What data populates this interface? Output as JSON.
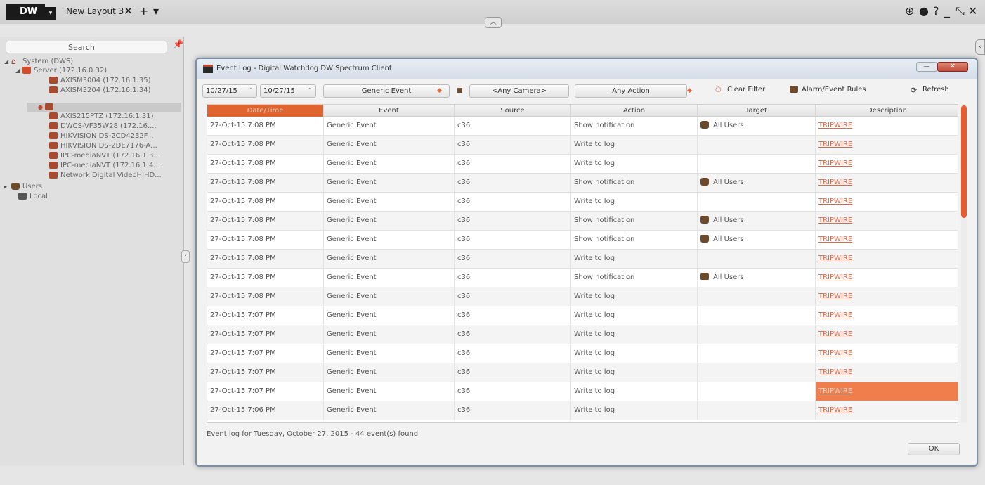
{
  "topbar": {
    "logo": "DW",
    "layout_tab": "New Layout 3",
    "tab_close": "✕",
    "tab_add": "+",
    "tab_menu": "▾",
    "right_icons": [
      "⊕",
      "●",
      "?",
      "_",
      "⤡",
      "✕"
    ]
  },
  "sidebar": {
    "search_placeholder": "Search",
    "tree": [
      {
        "label": "System (DWS)",
        "type": "home"
      },
      {
        "label": "Server (172.16.0.32)",
        "type": "server"
      },
      {
        "label": "AXISM3004 (172.16.1.35)",
        "type": "camera"
      },
      {
        "label": "AXISM3204 (172.16.1.34)",
        "type": "camera"
      },
      {
        "label": "",
        "type": "camera"
      },
      {
        "label": "AXIS215PTZ (172.16.1.31)",
        "type": "camera"
      },
      {
        "label": "DWCS-VF35W28 (172.16....",
        "type": "camera"
      },
      {
        "label": "HIKVISION DS-2CD4232F...",
        "type": "camera"
      },
      {
        "label": "HIKVISION DS-2DE7176-A...",
        "type": "camera"
      },
      {
        "label": "IPC-mediaNVT (172.16.1.3...",
        "type": "camera"
      },
      {
        "label": "IPC-mediaNVT (172.16.1.4...",
        "type": "camera"
      },
      {
        "label": "Network Digital VideoHIHD...",
        "type": "camera"
      },
      {
        "label": "Users",
        "type": "users"
      },
      {
        "label": "Local",
        "type": "local"
      }
    ]
  },
  "dialog": {
    "title": "Event Log - Digital Watchdog DW Spectrum Client",
    "minimize": "—",
    "close": "✕",
    "filters": {
      "date_from": "10/27/15",
      "date_to": "10/27/15",
      "event_type": "Generic Event",
      "camera": "<Any Camera>",
      "action": "Any Action",
      "clear_filter": "Clear Filter",
      "alarm_rules": "Alarm/Event Rules",
      "refresh": "Refresh"
    },
    "columns": [
      "Date/Time",
      "Event",
      "Source",
      "Action",
      "Target",
      "Description"
    ],
    "rows": [
      {
        "date": "27-Oct-15 7:08 PM",
        "event": "Generic Event",
        "source": "c36",
        "action": "Show notification",
        "target": "All Users",
        "desc": "TRIPWIRE"
      },
      {
        "date": "27-Oct-15 7:08 PM",
        "event": "Generic Event",
        "source": "c36",
        "action": "Write to log",
        "target": "",
        "desc": "TRIPWIRE"
      },
      {
        "date": "27-Oct-15 7:08 PM",
        "event": "Generic Event",
        "source": "c36",
        "action": "Write to log",
        "target": "",
        "desc": "TRIPWIRE"
      },
      {
        "date": "27-Oct-15 7:08 PM",
        "event": "Generic Event",
        "source": "c36",
        "action": "Show notification",
        "target": "All Users",
        "desc": "TRIPWIRE"
      },
      {
        "date": "27-Oct-15 7:08 PM",
        "event": "Generic Event",
        "source": "c36",
        "action": "Write to log",
        "target": "",
        "desc": "TRIPWIRE"
      },
      {
        "date": "27-Oct-15 7:08 PM",
        "event": "Generic Event",
        "source": "c36",
        "action": "Show notification",
        "target": "All Users",
        "desc": "TRIPWIRE"
      },
      {
        "date": "27-Oct-15 7:08 PM",
        "event": "Generic Event",
        "source": "c36",
        "action": "Show notification",
        "target": "All Users",
        "desc": "TRIPWIRE"
      },
      {
        "date": "27-Oct-15 7:08 PM",
        "event": "Generic Event",
        "source": "c36",
        "action": "Write to log",
        "target": "",
        "desc": "TRIPWIRE"
      },
      {
        "date": "27-Oct-15 7:08 PM",
        "event": "Generic Event",
        "source": "c36",
        "action": "Show notification",
        "target": "All Users",
        "desc": "TRIPWIRE"
      },
      {
        "date": "27-Oct-15 7:08 PM",
        "event": "Generic Event",
        "source": "c36",
        "action": "Write to log",
        "target": "",
        "desc": "TRIPWIRE"
      },
      {
        "date": "27-Oct-15 7:07 PM",
        "event": "Generic Event",
        "source": "c36",
        "action": "Write to log",
        "target": "",
        "desc": "TRIPWIRE"
      },
      {
        "date": "27-Oct-15 7:07 PM",
        "event": "Generic Event",
        "source": "c36",
        "action": "Write to log",
        "target": "",
        "desc": "TRIPWIRE"
      },
      {
        "date": "27-Oct-15 7:07 PM",
        "event": "Generic Event",
        "source": "c36",
        "action": "Write to log",
        "target": "",
        "desc": "TRIPWIRE"
      },
      {
        "date": "27-Oct-15 7:07 PM",
        "event": "Generic Event",
        "source": "c36",
        "action": "Write to log",
        "target": "",
        "desc": "TRIPWIRE"
      },
      {
        "date": "27-Oct-15 7:07 PM",
        "event": "Generic Event",
        "source": "c36",
        "action": "Write to log",
        "target": "",
        "desc": "TRIPWIRE",
        "highlight": true
      },
      {
        "date": "27-Oct-15 7:06 PM",
        "event": "Generic Event",
        "source": "c36",
        "action": "Write to log",
        "target": "",
        "desc": "TRIPWIRE"
      }
    ],
    "status": "Event log for Tuesday, October 27, 2015 - 44 event(s) found",
    "ok_label": "OK"
  },
  "colors": {
    "accent": "#e0642e",
    "link": "#d9684a",
    "highlight": "#f07e4c"
  }
}
